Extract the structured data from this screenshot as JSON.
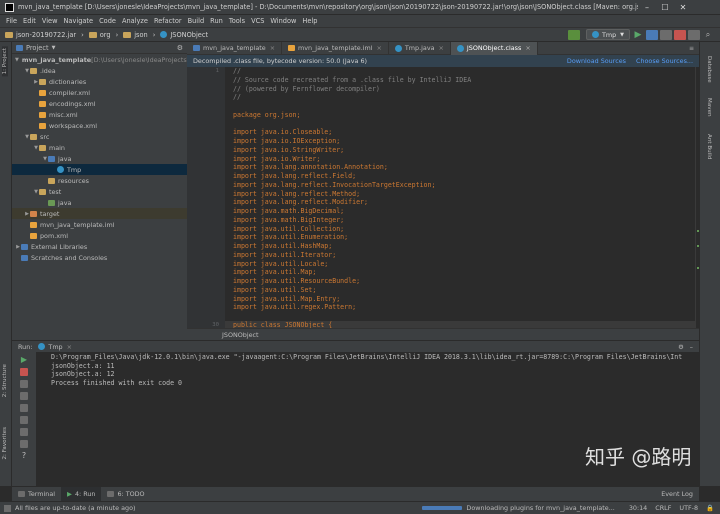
{
  "window": {
    "title": "mvn_java_template [D:\\Users\\jonesle\\IdeaProjects\\mvn_java_template] - D:\\Documents\\mvn\\repository\\org\\json\\json\\20190722\\json-20190722.jar!\\org\\json\\JSONObject.class [Maven: org.json:json:2019072...",
    "min": "–",
    "max": "☐",
    "close": "✕"
  },
  "menu": [
    "File",
    "Edit",
    "View",
    "Navigate",
    "Code",
    "Analyze",
    "Refactor",
    "Build",
    "Run",
    "Tools",
    "VCS",
    "Window",
    "Help"
  ],
  "navbar": {
    "crumbs": [
      "json-20190722.jar",
      "org",
      "json",
      "JSONObject"
    ],
    "run_config": "Tmp"
  },
  "side_tabs": {
    "project": "1: Project",
    "structure": "2: Structure",
    "favorites": "2: Favorites"
  },
  "right_tabs": [
    "Database",
    "Maven",
    "Ant Build"
  ],
  "project_panel": {
    "title": "Project",
    "tree": [
      {
        "depth": 0,
        "arrow": "▼",
        "icon": "folder",
        "label": "mvn_java_template",
        "suffix": " [D:\\Users\\jonesle\\IdeaProjects\\mvn_java_template]"
      },
      {
        "depth": 1,
        "arrow": "▼",
        "icon": "folder",
        "label": ".idea"
      },
      {
        "depth": 2,
        "arrow": "▶",
        "icon": "folder",
        "label": "dictionaries"
      },
      {
        "depth": 2,
        "arrow": "",
        "icon": "xml",
        "label": "compiler.xml"
      },
      {
        "depth": 2,
        "arrow": "",
        "icon": "xml",
        "label": "encodings.xml"
      },
      {
        "depth": 2,
        "arrow": "",
        "icon": "xml",
        "label": "misc.xml"
      },
      {
        "depth": 2,
        "arrow": "",
        "icon": "xml",
        "label": "workspace.xml"
      },
      {
        "depth": 1,
        "arrow": "▼",
        "icon": "folder",
        "label": "src"
      },
      {
        "depth": 2,
        "arrow": "▼",
        "icon": "folder",
        "label": "main"
      },
      {
        "depth": 3,
        "arrow": "▼",
        "icon": "blue",
        "label": "java"
      },
      {
        "depth": 4,
        "arrow": "",
        "icon": "class",
        "label": "Tmp"
      },
      {
        "depth": 3,
        "arrow": "",
        "icon": "folder",
        "label": "resources"
      },
      {
        "depth": 2,
        "arrow": "▼",
        "icon": "folder",
        "label": "test"
      },
      {
        "depth": 3,
        "arrow": "",
        "icon": "green",
        "label": "java"
      },
      {
        "depth": 1,
        "arrow": "▶",
        "icon": "orange",
        "label": "target"
      },
      {
        "depth": 1,
        "arrow": "",
        "icon": "xml",
        "label": "mvn_java_template.iml"
      },
      {
        "depth": 1,
        "arrow": "",
        "icon": "xml",
        "label": "pom.xml"
      },
      {
        "depth": 0,
        "arrow": "▶",
        "icon": "blue",
        "label": "External Libraries"
      },
      {
        "depth": 0,
        "arrow": "",
        "icon": "blue",
        "label": "Scratches and Consoles"
      }
    ]
  },
  "editor": {
    "tabs": [
      {
        "label": "mvn_java_template",
        "active": false
      },
      {
        "label": "mvn_java_template.iml",
        "active": false
      },
      {
        "label": "Tmp.java",
        "active": false
      },
      {
        "label": "JSONObject.class",
        "active": true
      }
    ],
    "banner": "Decompiled .class file, bytecode version: 50.0 (Java 6)",
    "download_sources": "Download Sources",
    "choose_sources": "Choose Sources...",
    "line_numbers": [
      "1",
      "",
      "",
      "",
      "",
      "",
      "",
      "",
      "",
      "",
      "",
      "",
      "",
      "",
      "",
      "",
      "",
      "",
      "",
      "",
      "",
      "",
      "",
      "",
      "",
      "",
      "",
      "",
      "",
      "30"
    ],
    "code": [
      {
        "cls": "cmt",
        "text": "//"
      },
      {
        "cls": "cmt",
        "text": "// Source code recreated from a .class file by IntelliJ IDEA"
      },
      {
        "cls": "cmt",
        "text": "// (powered by Fernflower decompiler)"
      },
      {
        "cls": "cmt",
        "text": "//"
      },
      {
        "cls": "",
        "text": ""
      },
      {
        "cls": "kw",
        "text": "package org.json;"
      },
      {
        "cls": "",
        "text": ""
      },
      {
        "cls": "kw",
        "text": "import java.io.Closeable;"
      },
      {
        "cls": "kw",
        "text": "import java.io.IOException;"
      },
      {
        "cls": "kw",
        "text": "import java.io.StringWriter;"
      },
      {
        "cls": "kw",
        "text": "import java.io.Writer;"
      },
      {
        "cls": "kw",
        "text": "import java.lang.annotation.Annotation;"
      },
      {
        "cls": "kw",
        "text": "import java.lang.reflect.Field;"
      },
      {
        "cls": "kw",
        "text": "import java.lang.reflect.InvocationTargetException;"
      },
      {
        "cls": "kw",
        "text": "import java.lang.reflect.Method;"
      },
      {
        "cls": "kw",
        "text": "import java.lang.reflect.Modifier;"
      },
      {
        "cls": "kw",
        "text": "import java.math.BigDecimal;"
      },
      {
        "cls": "kw",
        "text": "import java.math.BigInteger;"
      },
      {
        "cls": "kw",
        "text": "import java.util.Collection;"
      },
      {
        "cls": "kw",
        "text": "import java.util.Enumeration;"
      },
      {
        "cls": "kw",
        "text": "import java.util.HashMap;"
      },
      {
        "cls": "kw",
        "text": "import java.util.Iterator;"
      },
      {
        "cls": "kw",
        "text": "import java.util.Locale;"
      },
      {
        "cls": "kw",
        "text": "import java.util.Map;"
      },
      {
        "cls": "kw",
        "text": "import java.util.ResourceBundle;"
      },
      {
        "cls": "kw",
        "text": "import java.util.Set;"
      },
      {
        "cls": "kw",
        "text": "import java.util.Map.Entry;"
      },
      {
        "cls": "kw",
        "text": "import java.util.regex.Pattern;"
      },
      {
        "cls": "",
        "text": ""
      },
      {
        "cls": "kw",
        "text": "public class JSONObject {"
      }
    ],
    "footer_crumb": "JSONObject"
  },
  "run_panel": {
    "label": "Run:",
    "tab": "Tmp",
    "output": [
      "D:\\Program_Files\\Java\\jdk-12.0.1\\bin\\java.exe \"-javaagent:C:\\Program Files\\JetBrains\\IntelliJ IDEA 2018.3.1\\lib\\idea_rt.jar=8789:C:\\Program Files\\JetBrains\\Int",
      "jsonObject.a: 11",
      "jsonObject.a: 12",
      "",
      "Process finished with exit code 0"
    ]
  },
  "bottom_tabs": [
    {
      "label": "Terminal",
      "active": false
    },
    {
      "label": "4: Run",
      "active": true
    },
    {
      "label": "6: TODO",
      "active": false
    }
  ],
  "event_log": "Event Log",
  "status": {
    "left": "All files are up-to-date (a minute ago)",
    "task": "Downloading plugins for mvn_java_template...",
    "position": "30:14",
    "line_sep": "CRLF",
    "encoding": "UTF-8"
  },
  "watermark": "知乎 @路明"
}
